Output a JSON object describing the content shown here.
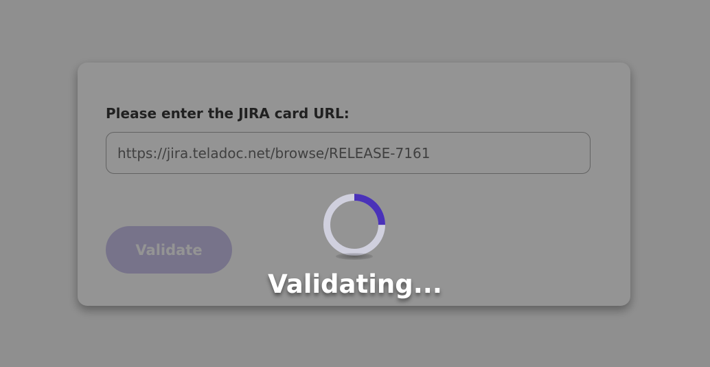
{
  "form": {
    "label": "Please enter the JIRA card URL:",
    "url_value": "https://jira.teladoc.net/browse/RELEASE-7161",
    "validate_label": "Validate"
  },
  "loading": {
    "text": "Validating...",
    "spinner_progress": 0.25
  },
  "colors": {
    "accent": "#4a32b8",
    "button_disabled": "#cdc6ee",
    "spinner_track": "#d0d0de"
  }
}
